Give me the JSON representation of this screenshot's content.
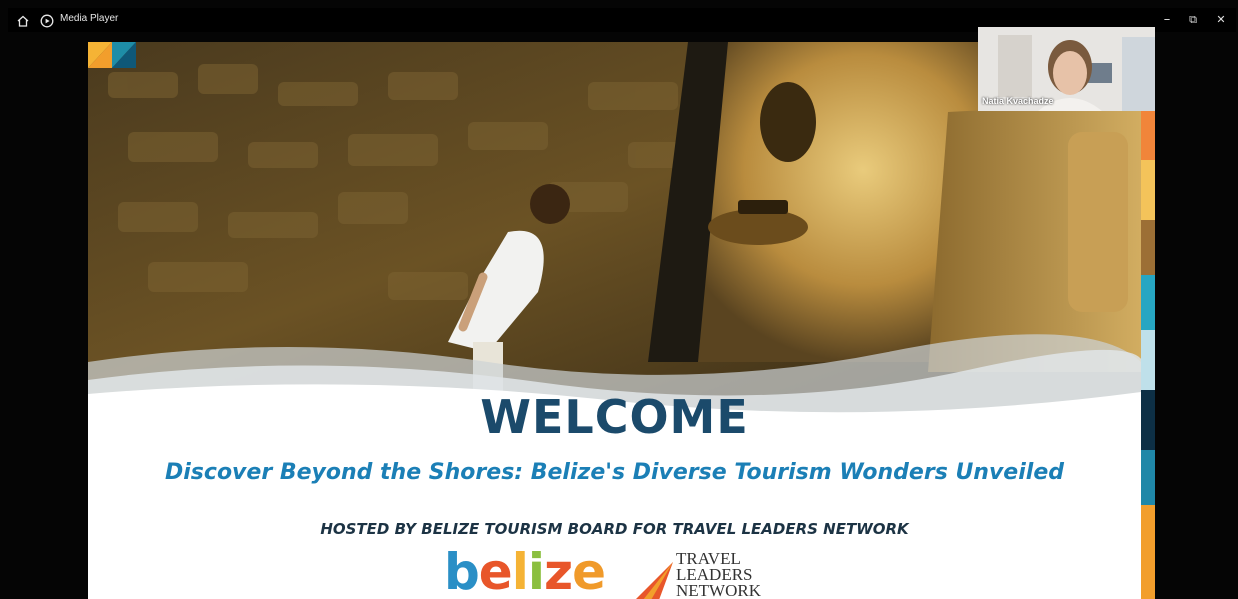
{
  "window": {
    "app_title": "Media Player",
    "home_icon": "home-icon",
    "app_icon": "media-player-icon",
    "controls": {
      "minimize": "–",
      "restore": "⧉",
      "close": "✕"
    }
  },
  "slide": {
    "welcome": "WELCOME",
    "subtitle": "Discover Beyond the Shores: Belize's Diverse Tourism Wonders Unveiled",
    "hosted_by": "HOSTED BY BELIZE TOURISM BOARD FOR TRAVEL LEADERS NETWORK",
    "brand_belize": {
      "b": "b",
      "e1": "e",
      "l": "l",
      "i": "i",
      "z": "z",
      "e2": "e"
    },
    "tln_lines": [
      "TRAVEL",
      "LEADERS",
      "NETWORK"
    ],
    "colors": {
      "title": "#1b4a6b",
      "subtitle": "#1b7fb6",
      "hosted": "#1c3344"
    }
  },
  "video_tile": {
    "participant_name": "Natia Kvachadze"
  }
}
